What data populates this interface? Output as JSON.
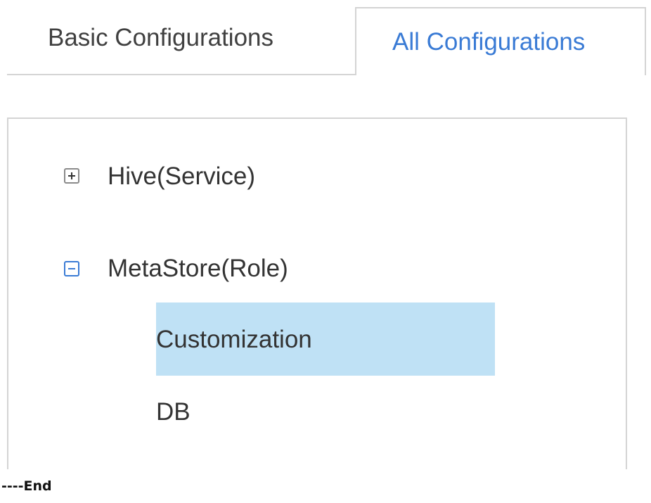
{
  "tabs": [
    {
      "label": "Basic Configurations",
      "active": false
    },
    {
      "label": "All Configurations",
      "active": true
    }
  ],
  "tree": {
    "nodes": [
      {
        "label": "Hive(Service)",
        "state": "collapsed",
        "icon": "plus-box-icon"
      },
      {
        "label": "MetaStore(Role)",
        "state": "expanded",
        "icon": "minus-box-icon",
        "children": [
          {
            "label": "Customization",
            "selected": true
          },
          {
            "label": "DB",
            "selected": false
          }
        ]
      }
    ]
  },
  "footer": {
    "text": "----End"
  },
  "colors": {
    "active_tab_text": "#3a7bd5",
    "selected_row_bg": "#bfe1f5",
    "border": "#d4d4d4"
  }
}
